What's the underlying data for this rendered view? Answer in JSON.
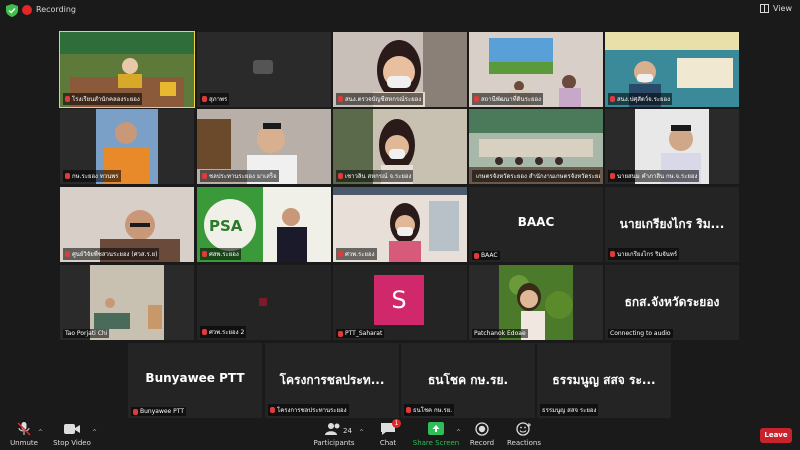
{
  "topbar": {
    "recording_label": "Recording",
    "view_label": "View",
    "shield_color": "#3fbf4a",
    "rec_color": "#e02828"
  },
  "tiles": [
    {
      "caption": "โรงเรียนสำนักคลองระยอง",
      "banner": "สำนักงานเกษตรจังหวัดระยอง",
      "active": true
    },
    {
      "caption": "สุภาพร"
    },
    {
      "caption": "สนง.ตรวจบัญชีสหกรณ์ระยอง"
    },
    {
      "caption": "สถานีพัฒนาที่ดินระยอง"
    },
    {
      "caption": "สนง.ปศุสัตว์จ.ระยอง",
      "banner": "สำนักงานปศุสัตว์จังหวัดระยอง"
    },
    {
      "caption": "กษ.ระยอง ทวนพร"
    },
    {
      "caption": "ชลประทานระยอง มาเสร็จ"
    },
    {
      "caption": "เชาวลิน สหกรณ์ จ.ระยอง"
    },
    {
      "caption": "เกษตรจังหวัดระยอง สำนักงานเกษตรจังหวัดระยอง"
    },
    {
      "caption": "นายสนม คำภาสิน กษ.จ.ระยอง"
    },
    {
      "caption": "ศูนย์วิจัยพืชสวนระยอง (ศวส.ร.ย)"
    },
    {
      "caption": "ศสพ.ระยอง",
      "logo_text": "PSA"
    },
    {
      "caption": "ศวพ.ระยอง"
    },
    {
      "caption": "BAAC",
      "big": "BAAC"
    },
    {
      "caption": "นายเกรียงไกร ริมจันทร์",
      "big": "นายเกรียงไกร ริม..."
    },
    {
      "caption": "Tao Porjati Chi"
    },
    {
      "caption": "ศวพ.ระยอง 2"
    },
    {
      "caption": "PTT_Saharat",
      "avatar_letter": "S"
    },
    {
      "caption": "Patchanok Edoae"
    },
    {
      "caption": "Connecting to audio",
      "big": "ธกส.จังหวัดระยอง"
    },
    {
      "caption": "Bunyawee PTT",
      "big": "Bunyawee PTT"
    },
    {
      "caption": "โครงการชลประทานระยอง",
      "big": "โครงการชลประท..."
    },
    {
      "caption": "ธนโชค กษ.รย.",
      "big": "ธนโชค กษ.รย."
    },
    {
      "caption": "ธรรมนูญ สสจ ระยอง",
      "big": "ธรรมนูญ สสจ ระ..."
    }
  ],
  "toolbar": {
    "unmute": "Unmute",
    "stop_video": "Stop Video",
    "participants": "Participants",
    "participant_count": "24",
    "chat": "Chat",
    "chat_badge": "1",
    "share_screen": "Share Screen",
    "record": "Record",
    "reactions": "Reactions",
    "leave": "Leave",
    "share_color": "#2ebd59",
    "leave_color": "#c8232c"
  }
}
